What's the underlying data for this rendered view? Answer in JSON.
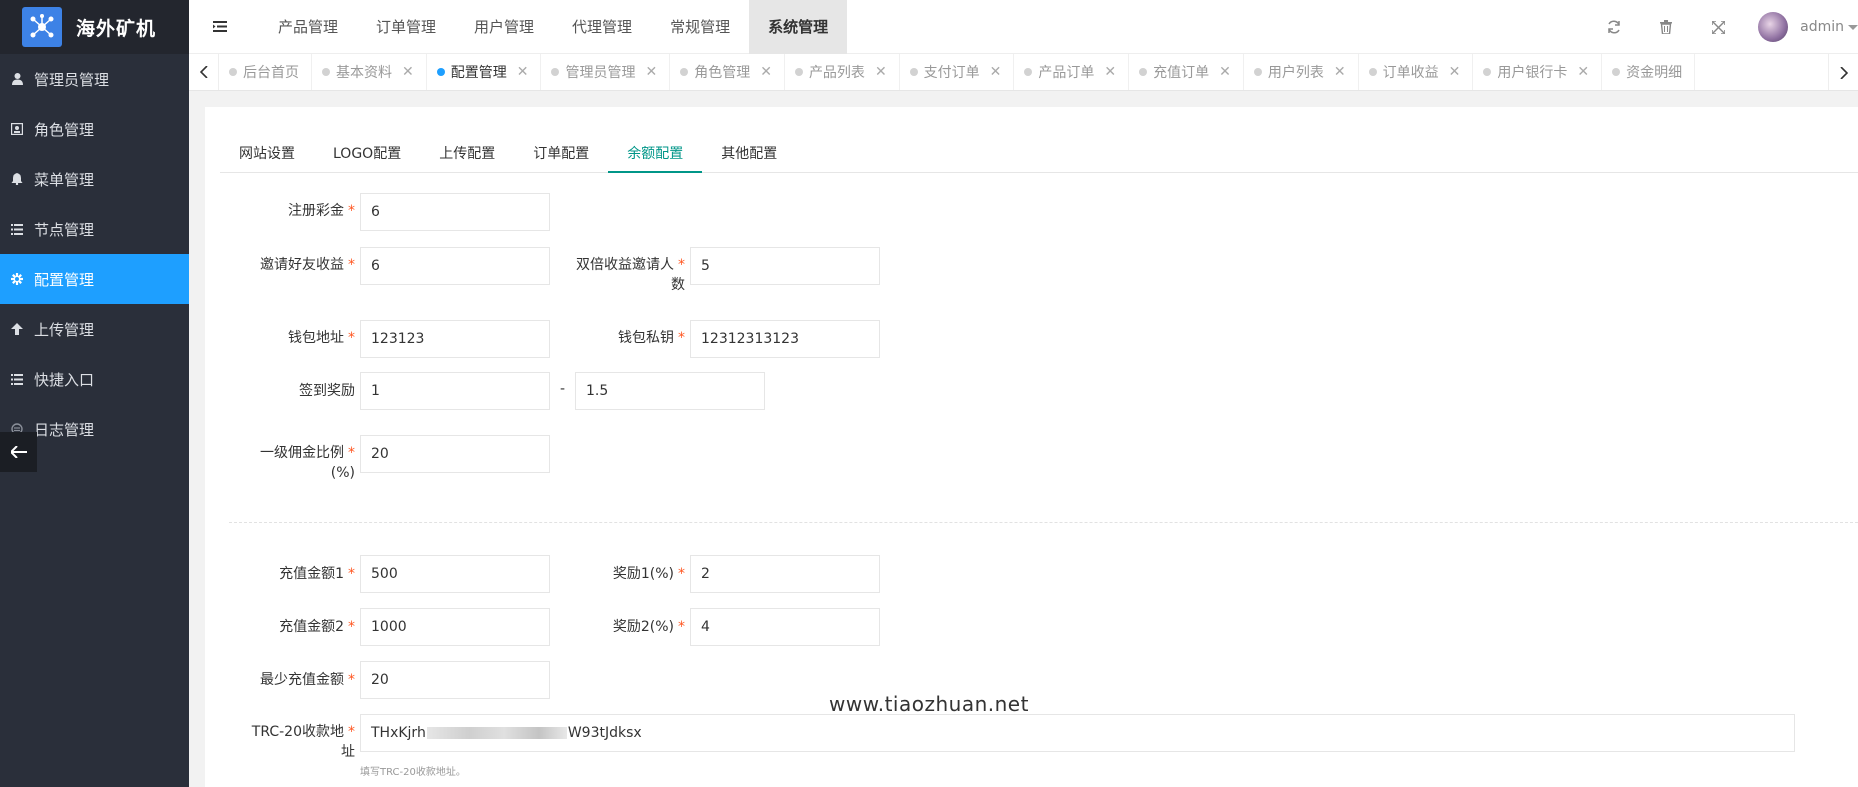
{
  "app": {
    "title": "海外矿机"
  },
  "sidebar": {
    "items": [
      {
        "label": "管理员管理",
        "icon": "user-icon"
      },
      {
        "label": "角色管理",
        "icon": "id-card-icon"
      },
      {
        "label": "菜单管理",
        "icon": "bell-icon"
      },
      {
        "label": "节点管理",
        "icon": "list-icon"
      },
      {
        "label": "配置管理",
        "icon": "gear-icon",
        "active": true
      },
      {
        "label": "上传管理",
        "icon": "arrow-up-icon"
      },
      {
        "label": "快捷入口",
        "icon": "list-icon"
      },
      {
        "label": "日志管理",
        "icon": "log-icon"
      }
    ]
  },
  "header": {
    "nav": [
      "产品管理",
      "订单管理",
      "用户管理",
      "代理管理",
      "常规管理",
      "系统管理"
    ],
    "active_nav": "系统管理",
    "user": "admin"
  },
  "tabs": [
    {
      "label": "后台首页",
      "closable": false
    },
    {
      "label": "基本资料",
      "closable": true
    },
    {
      "label": "配置管理",
      "closable": true,
      "active": true
    },
    {
      "label": "管理员管理",
      "closable": true
    },
    {
      "label": "角色管理",
      "closable": true
    },
    {
      "label": "产品列表",
      "closable": true
    },
    {
      "label": "支付订单",
      "closable": true
    },
    {
      "label": "产品订单",
      "closable": true
    },
    {
      "label": "充值订单",
      "closable": true
    },
    {
      "label": "用户列表",
      "closable": true
    },
    {
      "label": "订单收益",
      "closable": true
    },
    {
      "label": "用户银行卡",
      "closable": true
    },
    {
      "label": "资金明细",
      "closable": false
    }
  ],
  "subtabs": [
    "网站设置",
    "LOGO配置",
    "上传配置",
    "订单配置",
    "余额配置",
    "其他配置"
  ],
  "active_subtab": "余额配置",
  "form": {
    "register_bonus": {
      "label": "注册彩金",
      "value": "6"
    },
    "invite_income": {
      "label": "邀请好友收益",
      "value": "6"
    },
    "double_invite": {
      "label_line1": "双倍收益邀请人",
      "label_line2": "数",
      "value": "5"
    },
    "wallet_address": {
      "label": "钱包地址",
      "value": "123123"
    },
    "wallet_key": {
      "label": "钱包私钥",
      "value": "12312313123"
    },
    "checkin_reward": {
      "label": "签到奖励",
      "min": "1",
      "separator": "-",
      "max": "1.5"
    },
    "commission": {
      "label_line1": "一级佣金比例",
      "label_line2": "(%)",
      "value": "20"
    },
    "recharge1": {
      "label": "充值金额1",
      "value": "500"
    },
    "reward1": {
      "label": "奖励1(%)",
      "value": "2"
    },
    "recharge2": {
      "label": "充值金额2",
      "value": "1000"
    },
    "reward2": {
      "label": "奖励2(%)",
      "value": "4"
    },
    "min_recharge": {
      "label": "最少充值金额",
      "value": "20"
    },
    "trc20": {
      "label_line1": "TRC-20收款地",
      "label_line2": "址",
      "value_prefix": "THxKjrh",
      "value_suffix": "W93tJdksx",
      "help": "填写TRC-20收款地址。"
    }
  },
  "required_mark": "*",
  "watermark": "www.tiaozhuan.net",
  "colors": {
    "sidebar_bg": "#2a2f3a",
    "active_blue": "#1e9fff",
    "subtab_green": "#009688",
    "required_red": "#ff5722"
  }
}
